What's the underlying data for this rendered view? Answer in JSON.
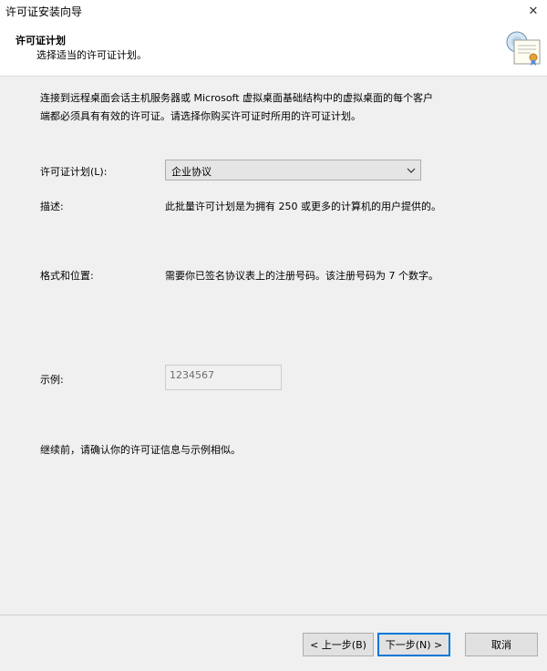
{
  "window": {
    "title": "许可证安装向导",
    "close_glyph": "✕"
  },
  "header": {
    "title": "许可证计划",
    "subtitle": "选择适当的许可证计划。"
  },
  "intro": {
    "line1": "连接到远程桌面会话主机服务器或 Microsoft 虚拟桌面基础结构中的虚拟桌面的每个客户",
    "line2": "端都必须具有有效的许可证。请选择你购买许可证时所用的许可证计划。"
  },
  "license_plan": {
    "label": "许可证计划(L):",
    "selected": "企业协议"
  },
  "description": {
    "label": "描述:",
    "value": "此批量许可计划是为拥有 250 或更多的计算机的用户提供的。"
  },
  "format": {
    "label": "格式和位置:",
    "value": "需要你已签名协议表上的注册号码。该注册号码为 7 个数字。"
  },
  "example": {
    "label": "示例:",
    "value": "1234567"
  },
  "continue_note": "继续前，请确认你的许可证信息与示例相似。",
  "buttons": {
    "back": "< 上一步(B)",
    "next": "下一步(N) >",
    "cancel": "取消"
  },
  "colors": {
    "accent": "#0078d7"
  }
}
